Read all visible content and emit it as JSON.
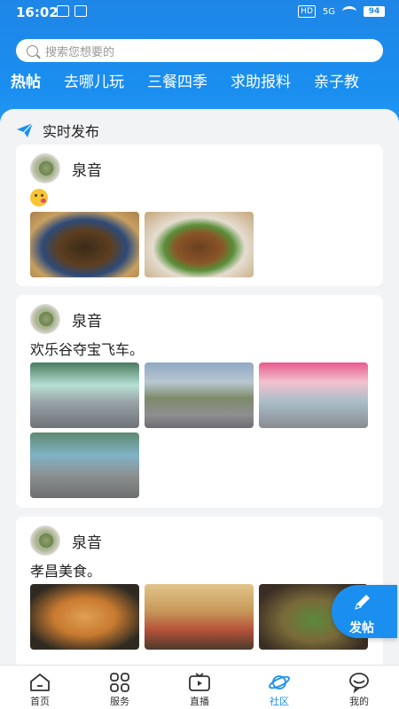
{
  "status_bar": {
    "time": "16:02",
    "hd_badge": "HD",
    "network": "5G",
    "battery": "94"
  },
  "search": {
    "placeholder": "搜索您想要的"
  },
  "tabs": [
    {
      "label": "热帖"
    },
    {
      "label": "去哪儿玩"
    },
    {
      "label": "三餐四季"
    },
    {
      "label": "求助报料"
    },
    {
      "label": "亲子教"
    }
  ],
  "section": {
    "title": "实时发布"
  },
  "posts": [
    {
      "author": "泉音",
      "text": "",
      "emoji": "kiss-emoji"
    },
    {
      "author": "泉音",
      "text": "欢乐谷夺宝飞车。"
    },
    {
      "author": "泉音",
      "text": "孝昌美食。"
    }
  ],
  "fab": {
    "label": "发帖"
  },
  "bottom_nav": [
    {
      "label": "首页",
      "icon": "home-icon"
    },
    {
      "label": "服务",
      "icon": "grid-icon"
    },
    {
      "label": "直播",
      "icon": "tv-icon"
    },
    {
      "label": "社区",
      "icon": "planet-icon",
      "active": true
    },
    {
      "label": "我的",
      "icon": "chat-person-icon"
    }
  ],
  "colors": {
    "primary": "#1a8ff0",
    "background": "#f2f3f5"
  }
}
